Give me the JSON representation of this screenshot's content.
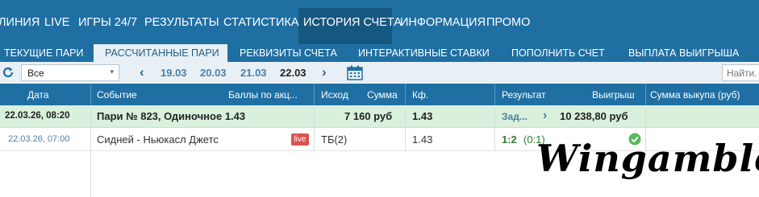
{
  "topnav": {
    "items": [
      "ЛИНИЯ",
      "LIVE",
      "ИГРЫ 24/7",
      "РЕЗУЛЬТАТЫ",
      "СТАТИСТИКА",
      "ИСТОРИЯ СЧЕТА",
      "ИНФОРМАЦИЯ",
      "ПРОМО"
    ],
    "active": "ИСТОРИЯ СЧЕТА"
  },
  "subnav": {
    "items": [
      "ТЕКУЩИЕ ПАРИ",
      "РАССЧИТАННЫЕ ПАРИ",
      "РЕКВИЗИТЫ СЧЕТА",
      "ИНТЕРАКТИВНЫЕ СТАВКИ",
      "ПОПОЛНИТЬ СЧЕТ",
      "ВЫПЛАТА ВЫИГРЫША"
    ],
    "active": "РАССЧИТАННЫЕ ПАРИ"
  },
  "toolbar": {
    "filter_value": "Все",
    "dates": [
      "19.03",
      "20.03",
      "21.03",
      "22.03"
    ],
    "current_date": "22.03",
    "search_placeholder": "Найти..."
  },
  "table": {
    "headers": {
      "date": "Дата",
      "event": "Событие",
      "points": "Баллы по акц...",
      "outcome": "Исход",
      "amount": "Сумма",
      "coef": "Кф.",
      "result": "Результат",
      "winnings": "Выигрыш",
      "buyout": "Сумма выкупа (руб)"
    },
    "bet_row": {
      "date": "22.03.26, 08:20",
      "event": "Пари № 823, Одиночное 1.43",
      "amount": "7 160 руб",
      "coef": "1.43",
      "result": "Зад...",
      "winnings": "10 238,80 руб"
    },
    "event_row": {
      "date": "22.03.26, 07:00",
      "event": "Сидней - Ньюкасл Джетс",
      "live_badge": "live",
      "outcome": "ТБ(2)",
      "coef": "1.43",
      "score": "1:2",
      "score_half": "(0:1)"
    }
  },
  "watermark": "Wingamble",
  "colors": {
    "nav_bg": "#1f6fa3",
    "nav_active": "#16587f",
    "toolbar_bg": "#e9f0f5",
    "row_win": "#d9f0dd",
    "live_badge": "#d9534f",
    "success": "#5cb85c"
  }
}
